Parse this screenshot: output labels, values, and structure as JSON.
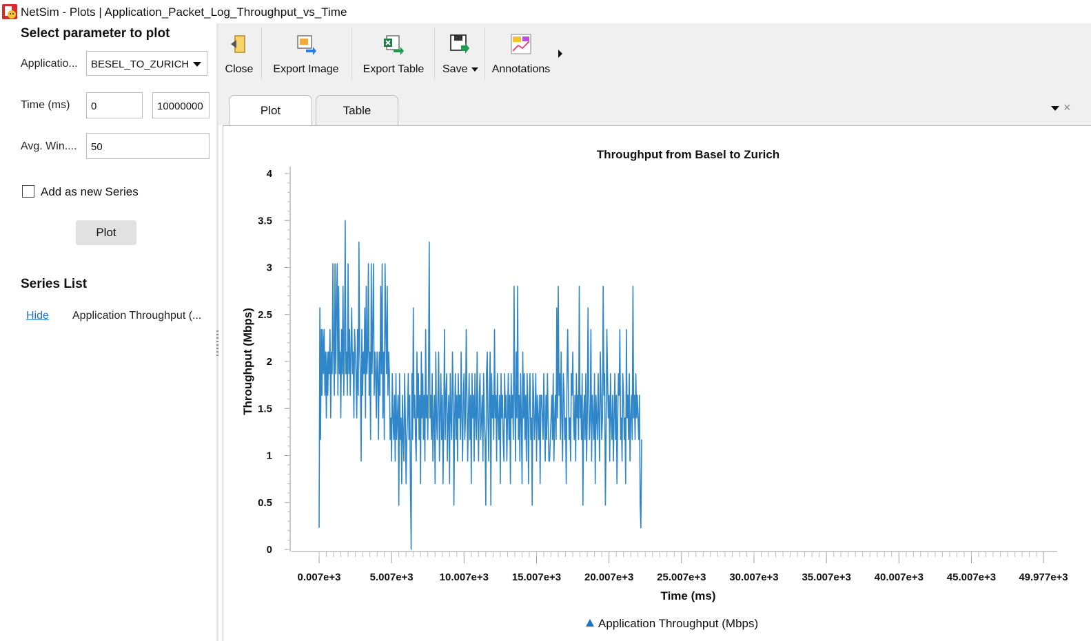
{
  "window": {
    "title": "NetSim - Plots | Application_Packet_Log_Throughput_vs_Time"
  },
  "left_panel": {
    "heading": "Select parameter to plot",
    "application_label": "Applicatio...",
    "application_value": "BESEL_TO_ZURICH",
    "time_label": "Time (ms)",
    "time_start": "0",
    "time_end": "10000000",
    "avg_window_label": "Avg. Win....",
    "avg_window_value": "50",
    "add_series_label": "Add as new Series",
    "add_series_checked": false,
    "plot_button": "Plot",
    "series_list_heading": "Series List",
    "series": [
      {
        "action": "Hide",
        "name": "Application Throughput (..."
      }
    ]
  },
  "toolbar": {
    "buttons": [
      {
        "label": "Close",
        "icon": "close-door-icon"
      },
      {
        "label": "Export Image",
        "icon": "export-image-icon"
      },
      {
        "label": "Export Table",
        "icon": "excel-export-icon"
      },
      {
        "label": "Save",
        "icon": "save-icon"
      },
      {
        "label": "Annotations",
        "icon": "annotations-icon"
      }
    ]
  },
  "tabs": [
    {
      "label": "Plot",
      "active": true
    },
    {
      "label": "Table",
      "active": false
    }
  ],
  "tab_close_glyph": "×",
  "colors": {
    "series": "#2f86c8",
    "toolbar_bg": "#f0f0f0",
    "link": "#1a73c8"
  },
  "chart_data": {
    "type": "line",
    "title": "Throughput from Basel to Zurich",
    "xlabel": "Time (ms)",
    "ylabel": "Throughput (Mbps)",
    "xlim": [
      7,
      49977
    ],
    "ylim": [
      0,
      4
    ],
    "x_ticks": [
      7,
      5007,
      10007,
      15007,
      20007,
      25007,
      30007,
      35007,
      40007,
      45007,
      49977
    ],
    "x_tick_labels": [
      "0.007e+3",
      "5.007e+3",
      "10.007e+3",
      "15.007e+3",
      "20.007e+3",
      "25.007e+3",
      "30.007e+3",
      "35.007e+3",
      "40.007e+3",
      "45.007e+3",
      "49.977e+3"
    ],
    "y_ticks": [
      0,
      0.5,
      1,
      1.5,
      2,
      2.5,
      3,
      3.5,
      4
    ],
    "y_tick_labels": [
      "0",
      "0.5",
      "1",
      "1.5",
      "2",
      "2.5",
      "3",
      "3.5",
      "4"
    ],
    "grid": false,
    "legend_position": "bottom-center",
    "series": [
      {
        "name": "Application Throughput (Mbps)",
        "color": "#2f86c8",
        "x_start": 7,
        "x_step": 50,
        "values": [
          0.23,
          2.57,
          1.17,
          2.34,
          1.64,
          2.34,
          1.87,
          2.34,
          1.64,
          2.1,
          1.4,
          2.1,
          1.64,
          2.1,
          1.87,
          2.34,
          1.4,
          2.1,
          1.87,
          3.04,
          2.1,
          1.64,
          3.04,
          1.87,
          2.57,
          3.04,
          1.64,
          2.8,
          1.87,
          2.1,
          1.4,
          2.34,
          1.87,
          2.8,
          1.64,
          2.1,
          3.5,
          1.87,
          2.1,
          1.64,
          3.04,
          1.87,
          2.34,
          1.64,
          2.1,
          2.57,
          1.87,
          2.1,
          1.4,
          2.34,
          2.1,
          1.87,
          1.4,
          2.34,
          1.64,
          3.27,
          2.1,
          1.87,
          0.94,
          2.34,
          1.64,
          2.1,
          1.87,
          2.57,
          1.4,
          2.8,
          1.87,
          2.1,
          3.04,
          1.64,
          2.1,
          1.17,
          3.04,
          1.87,
          2.34,
          3.04,
          1.64,
          2.1,
          1.87,
          1.4,
          2.1,
          1.87,
          1.17,
          2.1,
          1.64,
          2.8,
          1.87,
          3.04,
          1.4,
          2.1,
          1.17,
          3.04,
          2.34,
          1.87,
          2.8,
          1.64,
          2.1,
          1.87,
          1.17,
          1.4,
          0.94,
          1.87,
          1.4,
          1.17,
          1.64,
          0.94,
          1.87,
          1.17,
          1.4,
          1.64,
          0.47,
          1.87,
          1.17,
          1.4,
          0.7,
          1.64,
          1.17,
          0.94,
          1.87,
          1.4,
          0.7,
          1.17,
          1.4,
          1.87,
          1.17,
          1.64,
          0.7,
          0.0,
          1.87,
          1.17,
          2.57,
          1.4,
          1.64,
          1.17,
          0.94,
          2.1,
          1.4,
          1.87,
          1.17,
          1.64,
          0.7,
          2.1,
          1.4,
          1.87,
          1.17,
          1.64,
          0.94,
          2.34,
          1.4,
          1.64,
          1.17,
          1.87,
          3.27,
          1.4,
          1.64,
          1.17,
          1.87,
          0.94,
          1.4,
          1.64,
          0.7,
          2.1,
          1.4,
          1.17,
          1.64,
          2.1,
          0.94,
          1.4,
          1.87,
          1.17,
          1.64,
          0.7,
          1.4,
          2.34,
          1.17,
          1.64,
          1.87,
          0.94,
          1.4,
          1.64,
          0.7,
          1.87,
          1.4,
          1.17,
          2.1,
          1.64,
          0.47,
          1.4,
          1.87,
          1.17,
          1.64,
          0.94,
          1.87,
          1.4,
          1.64,
          1.17,
          2.1,
          1.4,
          0.94,
          1.64,
          1.87,
          1.17,
          1.4,
          2.34,
          1.64,
          0.94,
          1.4,
          1.87,
          1.17,
          1.64,
          0.7,
          1.87,
          1.4,
          1.64,
          0.94,
          1.87,
          1.4,
          1.17,
          2.1,
          1.4,
          0.94,
          1.64,
          1.87,
          1.17,
          1.4,
          1.64,
          0.94,
          1.87,
          1.4,
          1.17,
          0.47,
          1.87,
          2.1,
          1.4,
          0.94,
          1.64,
          2.1,
          0.47,
          1.87,
          1.4,
          1.64,
          1.17,
          2.34,
          1.4,
          1.64,
          0.94,
          1.87,
          1.4,
          1.17,
          1.64,
          0.7,
          1.87,
          1.4,
          1.64,
          1.17,
          0.94,
          1.87,
          1.4,
          1.64,
          0.94,
          1.4,
          1.87,
          1.17,
          1.64,
          0.7,
          1.87,
          1.4,
          1.64,
          1.17,
          2.8,
          1.64,
          0.94,
          2.1,
          1.4,
          2.8,
          1.17,
          1.64,
          0.94,
          1.87,
          1.4,
          0.7,
          2.1,
          1.4,
          1.87,
          1.17,
          1.64,
          0.94,
          1.87,
          1.4,
          0.7,
          1.64,
          1.87,
          1.17,
          1.4,
          0.47,
          1.87,
          1.64,
          1.17,
          1.4,
          1.87,
          0.94,
          1.64,
          1.4,
          1.17,
          1.64,
          0.7,
          1.64,
          1.64,
          1.4,
          1.17,
          1.87,
          1.4,
          0.94,
          1.64,
          1.17,
          1.87,
          1.4,
          0.94,
          0.94,
          1.17,
          1.4,
          1.64,
          1.17,
          1.87,
          0.94,
          1.4,
          1.64,
          1.17,
          2.57,
          1.4,
          2.8,
          1.64,
          1.87,
          1.17,
          2.1,
          1.4,
          0.94,
          1.87,
          1.64,
          1.17,
          1.4,
          0.7,
          1.87,
          2.34,
          1.64,
          1.17,
          1.4,
          0.94,
          1.87,
          1.64,
          2.1,
          1.4,
          1.17,
          1.64,
          0.94,
          1.87,
          1.4,
          1.64,
          1.17,
          2.8,
          1.4,
          1.64,
          1.17,
          1.87,
          0.47,
          1.4,
          1.64,
          1.17,
          1.87,
          0.94,
          1.4,
          2.57,
          1.64,
          1.17,
          1.4,
          2.34,
          0.94,
          1.64,
          1.4,
          1.17,
          1.87,
          0.7,
          1.64,
          1.4,
          1.17,
          1.87,
          1.4,
          0.94,
          2.1,
          1.64,
          1.17,
          1.4,
          2.8,
          1.64,
          1.87,
          0.47,
          1.17,
          2.34,
          1.87,
          1.4,
          1.64,
          0.94,
          1.87,
          1.4,
          1.17,
          1.64,
          0.94,
          1.4,
          1.87,
          1.17,
          1.64,
          0.7,
          1.4,
          1.87,
          1.64,
          2.34,
          1.17,
          1.4,
          0.94,
          1.87,
          1.64,
          1.17,
          1.4,
          0.7,
          2.34,
          1.4,
          1.64,
          1.17,
          1.87,
          0.94,
          1.4,
          1.64,
          1.17,
          2.8,
          1.4,
          1.64,
          1.17,
          1.87,
          1.4,
          1.64,
          1.4,
          1.17,
          1.64,
          0.47,
          0.23,
          1.17
        ]
      }
    ]
  }
}
